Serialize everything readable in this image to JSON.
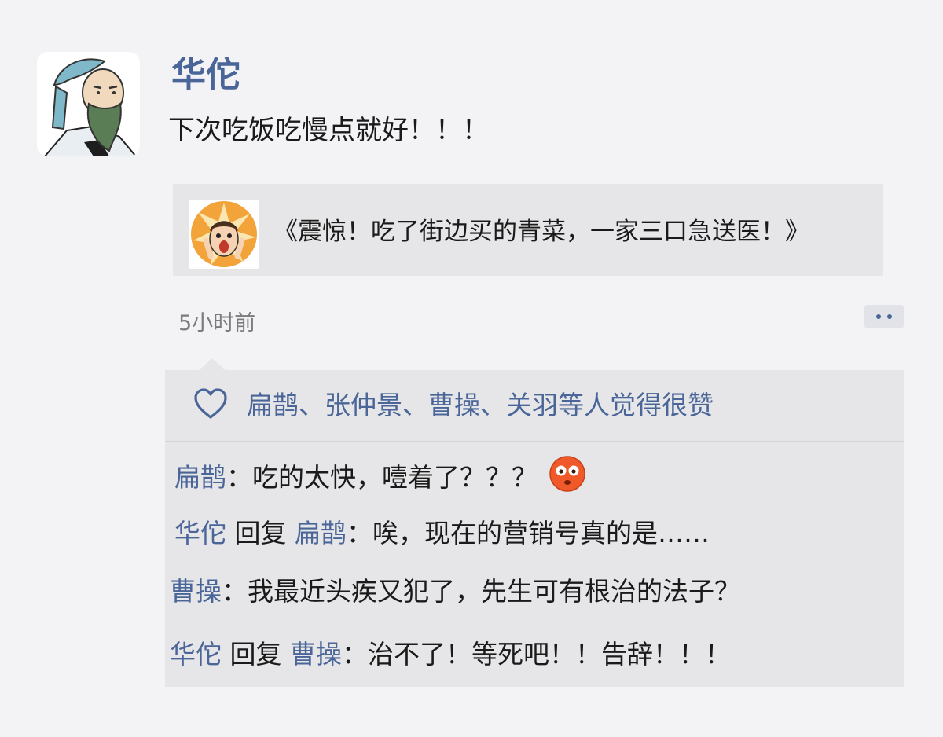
{
  "post": {
    "author": "华佗",
    "text": "下次吃饭吃慢点就好！！！",
    "shared_article_title": "《震惊！吃了街边买的青菜，一家三口急送医！》",
    "timestamp": "5小时前"
  },
  "likes": {
    "text": "扁鹊、张仲景、曹操、关羽等人觉得很赞"
  },
  "comments": [
    {
      "author": "扁鹊",
      "separator": "：",
      "text": "吃的太快，噎着了？？？"
    },
    {
      "author": "华佗",
      "reply_word": "回复",
      "reply_to": "扁鹊",
      "separator": "：",
      "text": "唉，现在的营销号真的是……"
    },
    {
      "author": "曹操",
      "separator": "：",
      "text": "我最近头疾又犯了，先生可有根治的法子？"
    },
    {
      "author": "华佗",
      "reply_word": "回复",
      "reply_to": "曹操",
      "separator": "：",
      "text": "治不了！等死吧！！告辞！！！"
    }
  ],
  "icons": {
    "avatar": "elderly-sage-portrait",
    "share_thumb": "shocked-face-thumbnail",
    "like": "heart-icon",
    "emoji": "flushed-face-emoji",
    "more": "more-dots-icon"
  },
  "colors": {
    "name_blue": "#4a6598",
    "background": "#f3f3f5",
    "panel": "#e6e6e8"
  }
}
